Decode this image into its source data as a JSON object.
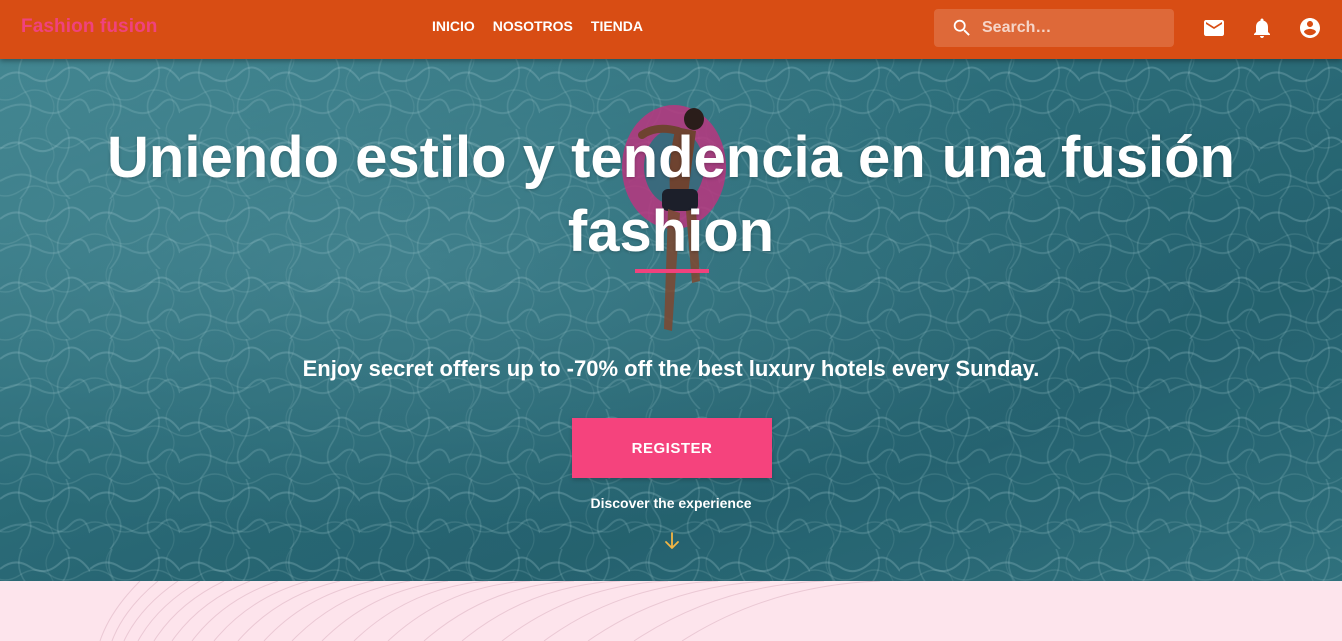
{
  "header": {
    "brand": "Fashion fusion",
    "nav": [
      "INICIO",
      "NOSOTROS",
      "TIENDA"
    ],
    "search": {
      "placeholder": "Search…",
      "value": ""
    },
    "icons": [
      "search-icon",
      "mail-icon",
      "notifications-icon",
      "account-circle-icon"
    ]
  },
  "hero": {
    "title": "Uniendo estilo y tendencia en una fusión fashion",
    "subtitle": "Enjoy secret offers up to -70% off the best luxury hotels every Sunday.",
    "cta_label": "REGISTER",
    "discover_label": "Discover the experience"
  },
  "colors": {
    "appbar": "#d84d14",
    "brand": "#f0427d",
    "accent": "#f5437d",
    "arrow": "#f2b544",
    "page_background": "#fde4ec"
  }
}
